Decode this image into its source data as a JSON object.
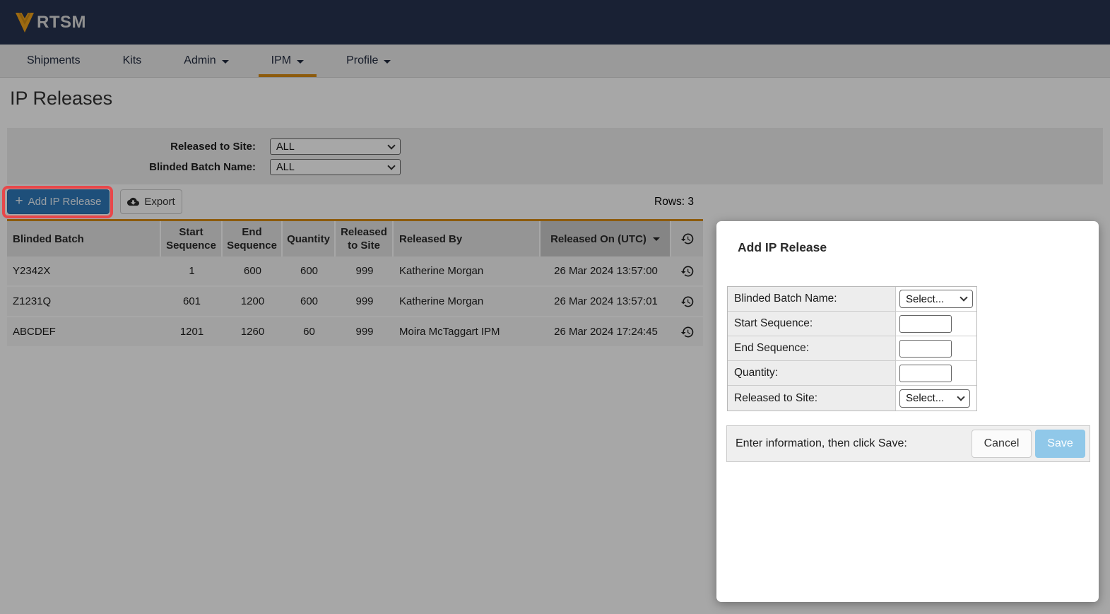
{
  "brand": {
    "logo_text": "RTSM"
  },
  "nav": {
    "items": [
      "Shipments",
      "Kits",
      "Admin",
      "IPM",
      "Profile"
    ],
    "active": "IPM"
  },
  "page": {
    "title": "IP Releases"
  },
  "filters": [
    {
      "label": "Released to Site:",
      "value": "ALL"
    },
    {
      "label": "Blinded Batch Name:",
      "value": "ALL"
    }
  ],
  "toolbar": {
    "add_button": "Add IP Release",
    "export_button": "Export",
    "rows_label": "Rows: 3"
  },
  "table": {
    "columns": [
      "Blinded Batch",
      "Start Sequence",
      "End Sequence",
      "Quantity",
      "Released to Site",
      "Released By",
      "Released On (UTC)"
    ],
    "sorted_column": "Released On (UTC)",
    "sort_direction": "desc",
    "rows": [
      {
        "blinded_batch": "Y2342X",
        "start_sequence": "1",
        "end_sequence": "600",
        "quantity": "600",
        "released_to_site": "999",
        "released_by": "Katherine Morgan",
        "released_on": "26 Mar 2024 13:57:00"
      },
      {
        "blinded_batch": "Z1231Q",
        "start_sequence": "601",
        "end_sequence": "1200",
        "quantity": "600",
        "released_to_site": "999",
        "released_by": "Katherine Morgan",
        "released_on": "26 Mar 2024 13:57:01"
      },
      {
        "blinded_batch": "ABCDEF",
        "start_sequence": "1201",
        "end_sequence": "1260",
        "quantity": "60",
        "released_to_site": "999",
        "released_by": "Moira McTaggart IPM",
        "released_on": "26 Mar 2024 17:24:45"
      }
    ]
  },
  "modal": {
    "title": "Add IP Release",
    "fields": [
      {
        "label": "Blinded Batch Name:",
        "control": "select",
        "value": "Select..."
      },
      {
        "label": "Start Sequence:",
        "control": "input",
        "value": ""
      },
      {
        "label": "End Sequence:",
        "control": "input",
        "value": ""
      },
      {
        "label": "Quantity:",
        "control": "input",
        "value": ""
      },
      {
        "label": "Released to Site:",
        "control": "select",
        "value": "Select..."
      }
    ],
    "footer": {
      "instruction": "Enter information, then click Save:",
      "cancel_label": "Cancel",
      "save_label": "Save"
    }
  },
  "icons": {
    "logo": "v-chevron-logo",
    "plus_glyph": "+",
    "export": "cloud-download-icon",
    "history": "history-icon",
    "sort": "sort-caret-icon",
    "dropdown": "chevron-down-icon"
  },
  "colors": {
    "navy_header": "#273350",
    "accent_orange": "#d78c15",
    "primary_button_blue": "#2e79ba",
    "save_button_blue": "#90c8e9",
    "annotation_red": "#e8474a"
  }
}
